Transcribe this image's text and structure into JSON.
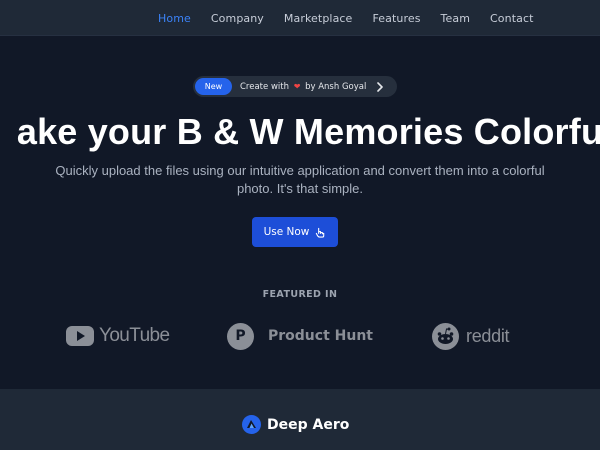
{
  "nav": {
    "items": [
      {
        "label": "Home",
        "active": true
      },
      {
        "label": "Company"
      },
      {
        "label": "Marketplace"
      },
      {
        "label": "Features"
      },
      {
        "label": "Team"
      },
      {
        "label": "Contact"
      }
    ]
  },
  "hero": {
    "badge": {
      "pill": "New",
      "text_before": "Create with",
      "heart_icon": "heart-icon",
      "text_after": "by Ansh Goyal"
    },
    "headline": "ake your B & W Memories Colorfu",
    "subtitle": "Quickly upload the files using our intuitive application and convert them into a colorful photo. It's that simple.",
    "cta_label": "Use Now",
    "featured_label": "FEATURED IN",
    "logos": [
      "YouTube",
      "Product Hunt",
      "reddit"
    ]
  },
  "footer": {
    "brand": "Deep Aero"
  },
  "colors": {
    "background": "#111827",
    "nav_background": "#1f2937",
    "accent": "#2563eb",
    "active_nav": "#3b82f6",
    "muted": "#8b8f97"
  }
}
